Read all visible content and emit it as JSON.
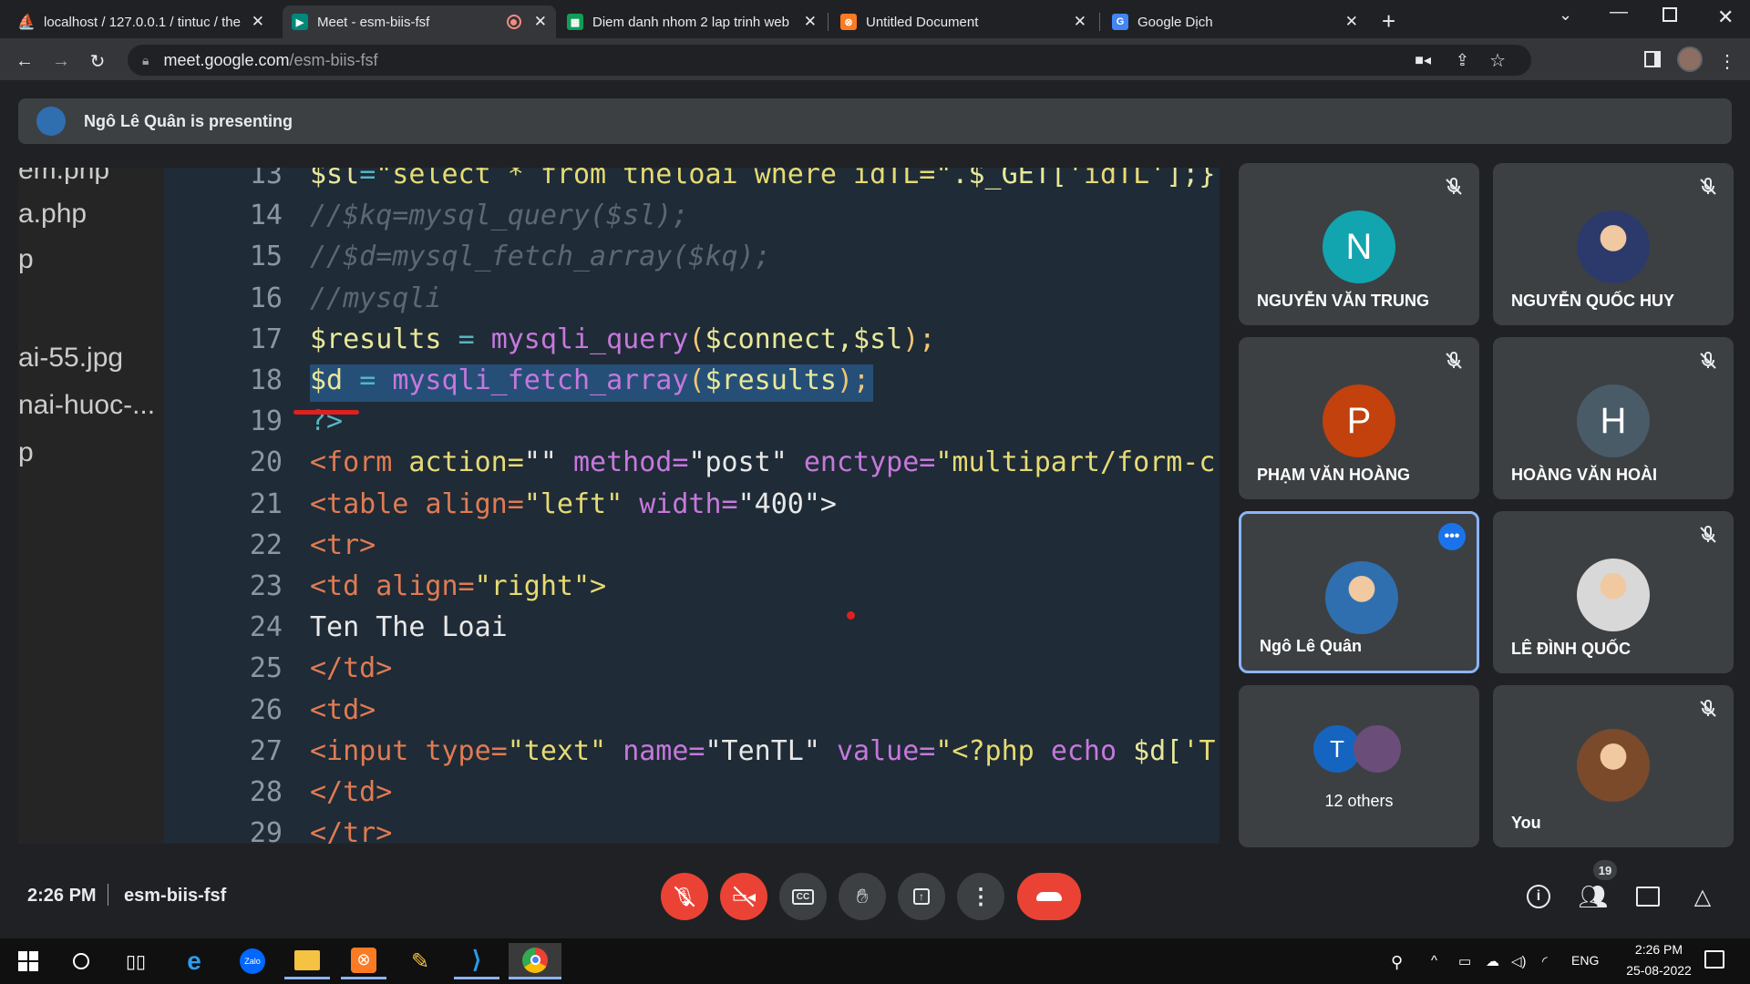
{
  "browser": {
    "tabs": [
      {
        "title": "localhost / 127.0.0.1 / tintuc / the",
        "icon": "phpmyadmin-icon",
        "color": "#f89c0e"
      },
      {
        "title": "Meet - esm-biis-fsf",
        "icon": "meet-icon",
        "color": "#00897b",
        "active": true
      },
      {
        "title": "Diem danh nhom 2 lap trinh web",
        "icon": "sheets-icon",
        "color": "#0f9d58"
      },
      {
        "title": "Untitled Document",
        "icon": "xampp-icon",
        "color": "#fb7a24"
      },
      {
        "title": "Google Dịch",
        "icon": "translate-icon",
        "color": "#4285f4"
      }
    ],
    "url_domain": "meet.google.com",
    "url_path": "/esm-biis-fsf"
  },
  "meet": {
    "presenting_banner": "Ngô Lê Quân is presenting",
    "time": "2:26 PM",
    "meeting_code": "esm-biis-fsf",
    "people_count": "19",
    "accent": "#8ab4f8",
    "danger": "#ea4335"
  },
  "shared_screen": {
    "files": [
      "em.php",
      "a.php",
      "p",
      "ai-55.jpg",
      "nai-huoc-...",
      "p"
    ],
    "code_lines": [
      {
        "n": "13",
        "tokens": [
          [
            "$sl",
            "#e8e89a"
          ],
          [
            "=",
            "#56b6c2"
          ],
          [
            "\"select * from theloai where idTL=\"",
            "#e6db74"
          ],
          [
            ".$_GET[",
            "#e8e89a"
          ],
          [
            "'idTL'",
            "#e6db74"
          ],
          [
            "];}",
            "#e8e89a"
          ]
        ]
      },
      {
        "n": "14",
        "tokens": [
          [
            "//$kq=mysql_query($sl);",
            "#5c6773"
          ]
        ]
      },
      {
        "n": "15",
        "tokens": [
          [
            "//$d=mysql_fetch_array($kq);",
            "#5c6773"
          ]
        ]
      },
      {
        "n": "16",
        "tokens": [
          [
            "//mysqli",
            "#5c6773"
          ]
        ]
      },
      {
        "n": "17",
        "tokens": [
          [
            "$results ",
            "#e8e89a"
          ],
          [
            "= ",
            "#56b6c2"
          ],
          [
            "mysqli_query",
            "#c678dd"
          ],
          [
            "(",
            "#f0c674"
          ],
          [
            "$connect,$sl",
            "#e8e89a"
          ],
          [
            ");",
            "#f0c674"
          ]
        ]
      },
      {
        "n": "18",
        "tokens": [
          [
            "$d ",
            "#e8e89a"
          ],
          [
            "= ",
            "#56b6c2"
          ],
          [
            "mysqli_fetch_array",
            "#c678dd"
          ],
          [
            "(",
            "#f0c674"
          ],
          [
            "$results",
            "#e8e89a"
          ],
          [
            ");",
            "#f0c674"
          ]
        ],
        "selected": true
      },
      {
        "n": "19",
        "tokens": [
          [
            "?>",
            "#56b6c2"
          ]
        ]
      },
      {
        "n": "20",
        "tokens": [
          [
            "<form ",
            "#e07b53"
          ],
          [
            "action=",
            "#e6db74"
          ],
          [
            "\"\" ",
            "#e8e8e8"
          ],
          [
            "method=",
            "#c678dd"
          ],
          [
            "\"post\" ",
            "#e8e8e8"
          ],
          [
            "enctype=",
            "#c678dd"
          ],
          [
            "\"multipart/form-c",
            "#e6db74"
          ]
        ]
      },
      {
        "n": "21",
        "tokens": [
          [
            "<table ",
            "#e07b53"
          ],
          [
            "align=",
            "#e07b53"
          ],
          [
            "\"left\" ",
            "#e6db74"
          ],
          [
            "width=",
            "#c678dd"
          ],
          [
            "\"400\">",
            "#e8e8e8"
          ]
        ]
      },
      {
        "n": "22",
        "tokens": [
          [
            "<tr>",
            "#e07b53"
          ]
        ]
      },
      {
        "n": "23",
        "tokens": [
          [
            "<td ",
            "#e07b53"
          ],
          [
            "align=",
            "#e07b53"
          ],
          [
            "\"right\">",
            "#e6db74"
          ]
        ]
      },
      {
        "n": "24",
        "tokens": [
          [
            "Ten The Loai",
            "#e8e8e8"
          ]
        ]
      },
      {
        "n": "25",
        "tokens": [
          [
            "</td>",
            "#e07b53"
          ]
        ]
      },
      {
        "n": "26",
        "tokens": [
          [
            "<td>",
            "#e07b53"
          ]
        ]
      },
      {
        "n": "27",
        "tokens": [
          [
            "<input ",
            "#e07b53"
          ],
          [
            "type=",
            "#e07b53"
          ],
          [
            "\"text\" ",
            "#e6db74"
          ],
          [
            "name=",
            "#c678dd"
          ],
          [
            "\"TenTL\" ",
            "#e8e8e8"
          ],
          [
            "value=",
            "#c678dd"
          ],
          [
            "\"<?php ",
            "#e6db74"
          ],
          [
            "echo ",
            "#c678dd"
          ],
          [
            "$d[",
            "#e8e89a"
          ],
          [
            "'T",
            "#e6db74"
          ]
        ]
      },
      {
        "n": "28",
        "tokens": [
          [
            "</td>",
            "#e07b53"
          ]
        ]
      },
      {
        "n": "29",
        "tokens": [
          [
            "</tr>",
            "#e07b53"
          ]
        ]
      }
    ]
  },
  "participants": [
    {
      "name": "NGUYỄN VĂN TRUNG",
      "initial": "N",
      "color": "#12a4af",
      "muted": true
    },
    {
      "name": "NGUYỄN QUỐC HUY",
      "initial": "",
      "color": "#2b3a6b",
      "muted": true,
      "photo": true
    },
    {
      "name": "PHẠM VĂN HOÀNG",
      "initial": "P",
      "color": "#c2410c",
      "muted": true
    },
    {
      "name": "HOÀNG VĂN HOÀI",
      "initial": "H",
      "color": "#4a5b68",
      "muted": true
    },
    {
      "name": "Ngô Lê Quân",
      "initial": "",
      "color": "#2f6fb0",
      "muted": false,
      "photo": true,
      "presenting": true
    },
    {
      "name": "LÊ ĐÌNH QUỐC",
      "initial": "",
      "color": "#d8d8d8",
      "muted": true,
      "photo": true
    },
    {
      "name": "12 others",
      "initial": "T",
      "color": "#1565c0",
      "muted": false,
      "group": true
    },
    {
      "name": "You",
      "initial": "",
      "color": "#7b4a2a",
      "muted": true,
      "photo": true
    }
  ],
  "taskbar": {
    "lang": "ENG",
    "time": "2:26 PM",
    "date": "25-08-2022"
  }
}
